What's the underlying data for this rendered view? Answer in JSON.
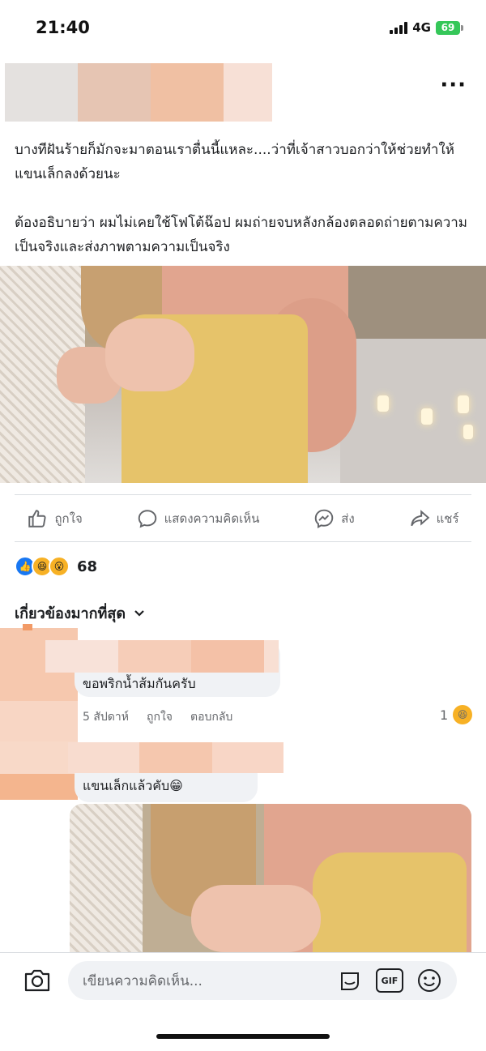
{
  "status_bar": {
    "time": "21:40",
    "network": "4G",
    "battery": "69"
  },
  "post": {
    "paragraph_1": "บางทีฝันร้ายก็มักจะมาตอนเราตื่นนี้แหละ....ว่าที่เจ้าสาวบอกว่าให้ช่วยทำให้แขนเล็กลงด้วยนะ",
    "paragraph_2": "ต้องอธิบายว่า ผมไม่เคยใช้โฟโต้ฉ๊อป ผมถ่ายจบหลังกล้องตลอดถ่ายตามความเป็นจริงและส่งภาพตามความเป็นจริง",
    "menu_icon": "more-dots-icon"
  },
  "actions": {
    "like": "ถูกใจ",
    "comment": "แสดงความคิดเห็น",
    "send": "ส่ง",
    "share": "แชร์"
  },
  "reactions": {
    "count": "68",
    "icons": [
      "like",
      "haha",
      "wow"
    ]
  },
  "sort_label": "เกี่ยวข้องมากที่สุด",
  "comments": [
    {
      "text": "ขอพริกน้ำส้มกันครับ",
      "time": "5 สัปดาห์",
      "like": "ถูกใจ",
      "reply": "ตอบกลับ",
      "reaction_count": "1"
    },
    {
      "text": "แขนเล็กแล้วคับ",
      "emoji": "😁"
    }
  ],
  "composer": {
    "placeholder": "เขียนความคิดเห็น...",
    "gif": "GIF"
  },
  "colors": {
    "accent": "#1877f2",
    "muted": "#65676b",
    "bubble": "#f0f2f5",
    "battery": "#35c759"
  }
}
